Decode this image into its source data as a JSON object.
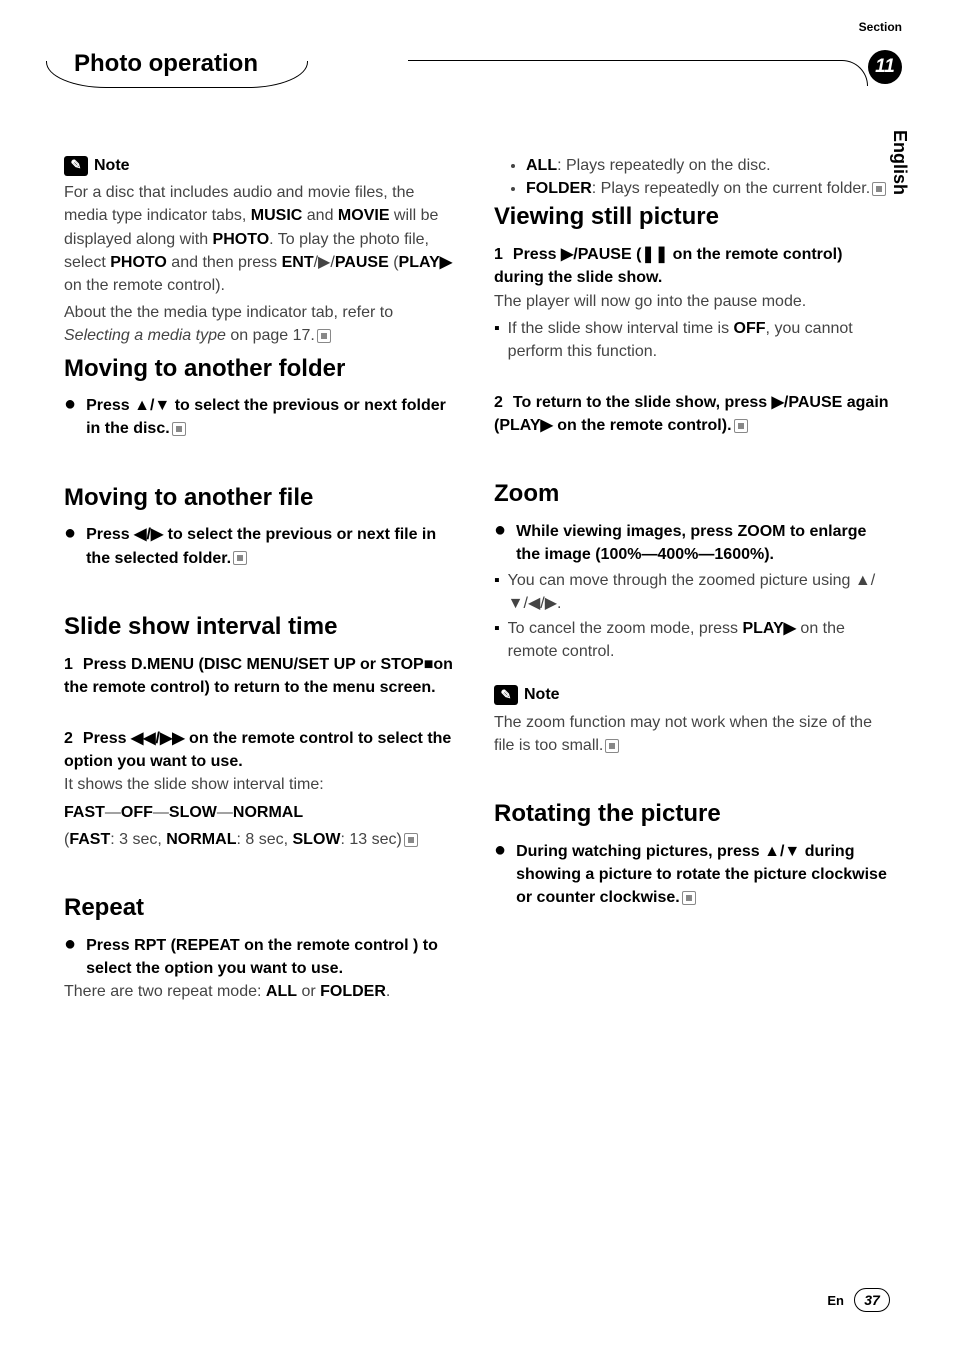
{
  "meta": {
    "section_label": "Section",
    "section_number": "11",
    "lang_tab": "English",
    "footer_lang": "En",
    "page_number": "37"
  },
  "header": {
    "title": "Photo operation"
  },
  "left": {
    "note": {
      "label": "Note",
      "text1": "For a disc that includes audio and movie files, the media type indicator tabs, ",
      "b1": "MUSIC",
      "text2": " and ",
      "b2": "MOVIE",
      "text3": " will be displayed along with ",
      "b3": "PHOTO",
      "text4": ". To play the photo file, select ",
      "b4": "PHOTO",
      "text5": " and then press ",
      "b5": "ENT",
      "text6": "/▶/",
      "b6": "PAUSE",
      "text7": " (",
      "b7": "PLAY▶",
      "text8": " on the remote control).",
      "text9": "About the the media type indicator tab, refer to ",
      "i1": "Selecting a media type",
      "text10": " on page 17."
    },
    "h_move_folder": "Moving to another folder",
    "move_folder_step": "Press ▲/▼ to select the previous or next folder in the disc.",
    "h_move_file": "Moving to another file",
    "move_file_step": "Press ◀/▶ to select the previous or next file in the selected folder.",
    "h_slide": "Slide show interval time",
    "slide_s1_num": "1",
    "slide_s1": "Press D.MENU (DISC MENU/SET UP or STOP■on the remote control) to return to the menu screen.",
    "slide_s2_num": "2",
    "slide_s2": "Press ◀◀/▶▶ on the remote control to select the option you want to use.",
    "slide_body1": "It shows the slide show interval time:",
    "slide_body2a": "FAST",
    "slide_body2b": "—",
    "slide_body2c": "OFF",
    "slide_body2d": "—",
    "slide_body2e": "SLOW",
    "slide_body2f": "—",
    "slide_body2g": "NORMAL",
    "slide_body3_open": "(",
    "slide_body3a": "FAST",
    "slide_body3b": ": 3 sec, ",
    "slide_body3c": "NORMAL",
    "slide_body3d": ": 8 sec, ",
    "slide_body3e": "SLOW",
    "slide_body3f": ": 13 sec)",
    "h_repeat": "Repeat",
    "repeat_step": "Press RPT (REPEAT on the remote control ) to select the option you want to use.",
    "repeat_b1": "There are two repeat mode: ",
    "repeat_b2": "ALL",
    "repeat_b3": " or ",
    "repeat_b4": "FOLDER",
    "repeat_b5": "."
  },
  "right": {
    "li1a": "ALL",
    "li1b": ": Plays repeatedly on the disc.",
    "li2a": "FOLDER",
    "li2b": ": Plays repeatedly on the current folder.",
    "h_view": "Viewing still picture",
    "view_s1_num": "1",
    "view_s1": "Press ▶/PAUSE (❚❚ on the remote control) during the slide show.",
    "view_b1": "The player will now go into the pause mode.",
    "view_sb1a": "If the slide show interval time is ",
    "view_sb1b": "OFF",
    "view_sb1c": ", you cannot perform this function.",
    "view_s2_num": "2",
    "view_s2": "To return to the slide show, press ▶/PAUSE again (PLAY▶ on the remote control).",
    "h_zoom": "Zoom",
    "zoom_step": "While viewing images, press ZOOM to enlarge the image (100%—400%—1600%).",
    "zoom_sb1": "You can move through the zoomed picture using ▲/▼/◀/▶.",
    "zoom_sb2a": "To cancel the zoom mode, press ",
    "zoom_sb2b": "PLAY▶",
    "zoom_sb2c": " on the remote control.",
    "zoom_note_label": "Note",
    "zoom_note": "The zoom function may not work when the size of the file is too small.",
    "h_rotate": "Rotating the picture",
    "rotate_step": "During watching pictures, press ▲/▼ during showing a picture to rotate the picture clockwise or counter clockwise."
  }
}
